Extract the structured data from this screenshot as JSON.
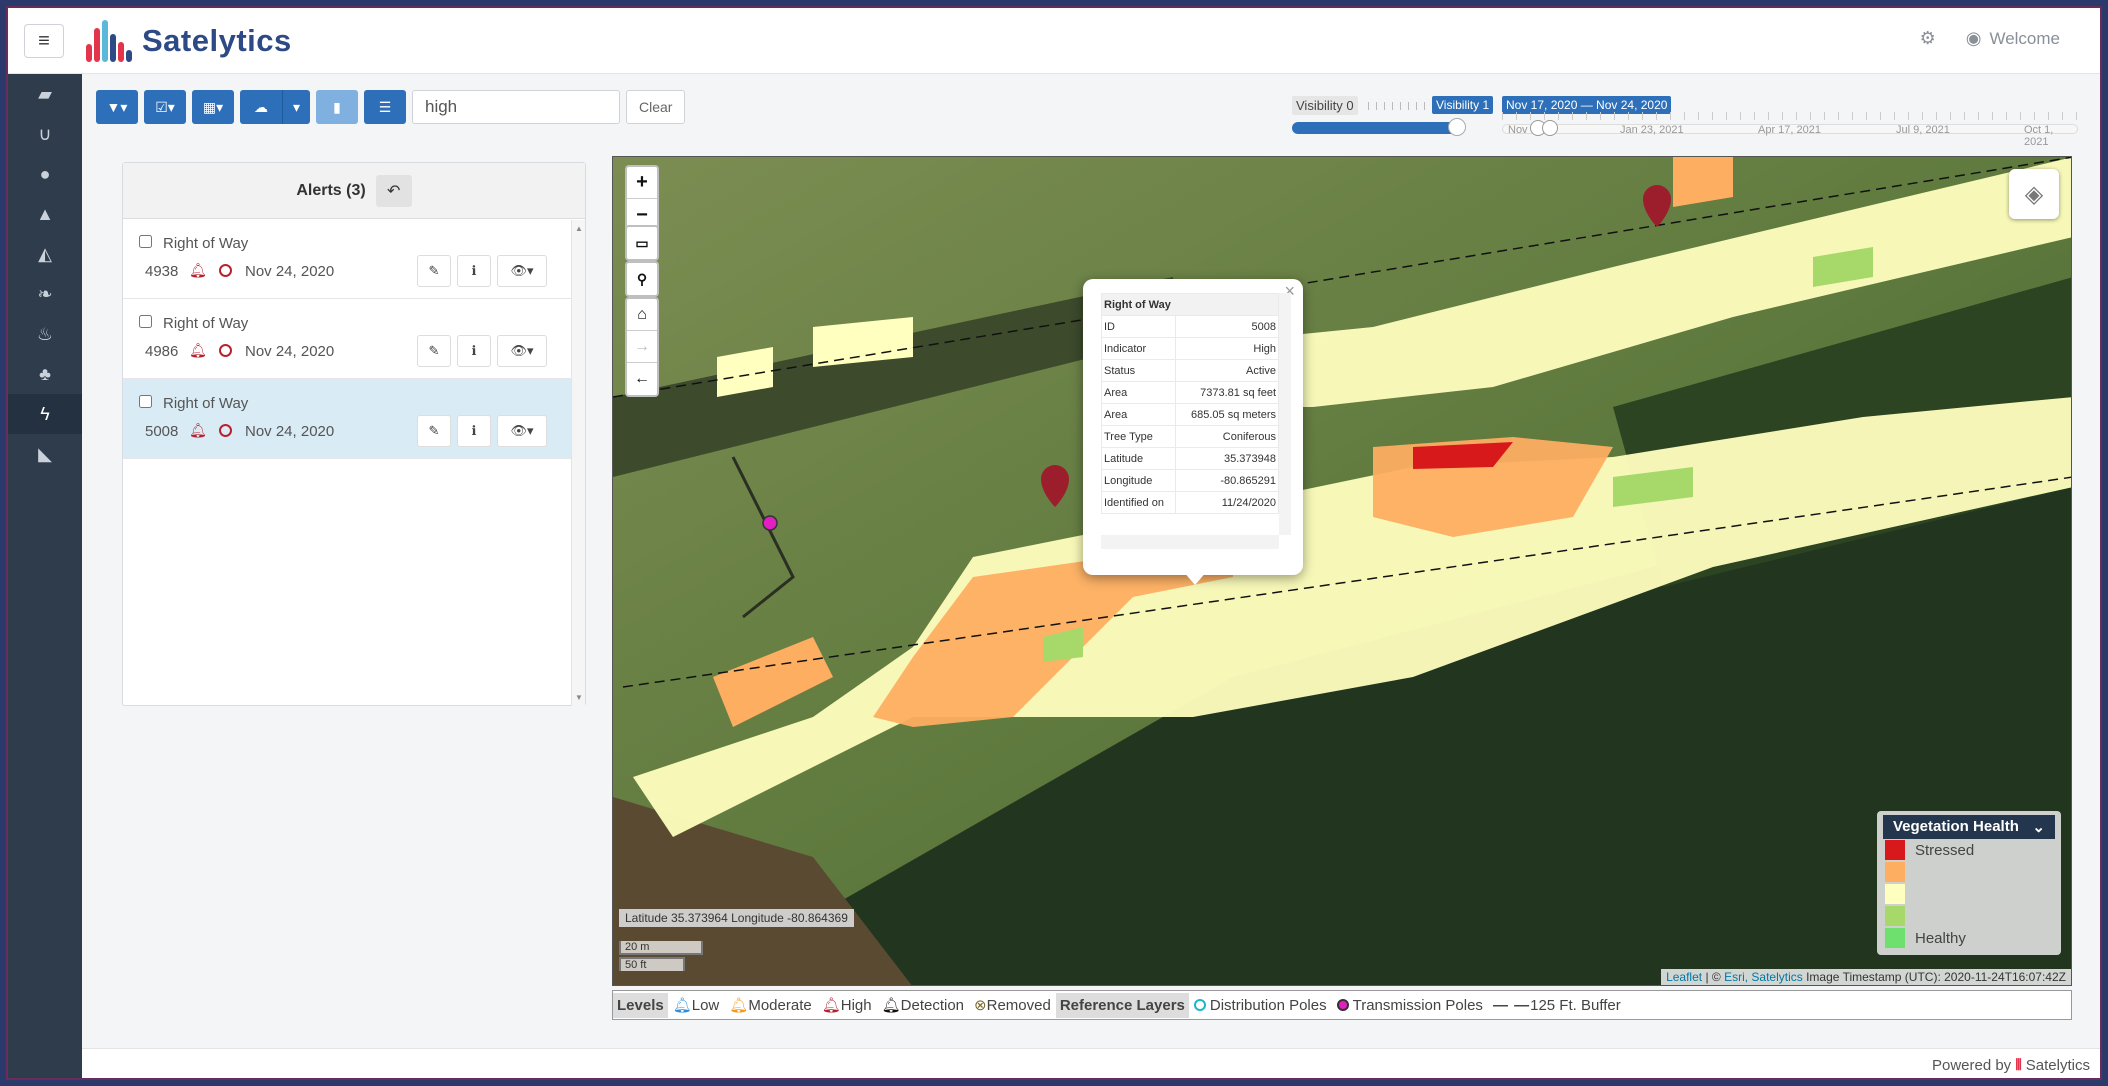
{
  "app": {
    "name": "Satelytics",
    "welcome": "Welcome",
    "powered_by": "Powered by",
    "brand": "Satelytics"
  },
  "toolbar": {
    "search_value": "high",
    "clear_label": "Clear"
  },
  "visibility": {
    "label_min": "Visibility 0",
    "label_value": "Visibility 1",
    "value": 1
  },
  "timeline": {
    "range_label": "Nov 17, 2020 — Nov 24, 2020",
    "ticks": [
      "Nov",
      "Jan 23, 2021",
      "Apr 17, 2021",
      "Jul 9, 2021",
      "Oct 1, 2021"
    ]
  },
  "alerts": {
    "title": "Alerts (3)",
    "items": [
      {
        "title": "Right of Way",
        "id": "4938",
        "date": "Nov 24, 2020",
        "selected": false
      },
      {
        "title": "Right of Way",
        "id": "4986",
        "date": "Nov 24, 2020",
        "selected": false
      },
      {
        "title": "Right of Way",
        "id": "5008",
        "date": "Nov 24, 2020",
        "selected": true
      }
    ]
  },
  "popup": {
    "title": "Right of Way",
    "rows": [
      {
        "k": "ID",
        "v": "5008"
      },
      {
        "k": "Indicator",
        "v": "High"
      },
      {
        "k": "Status",
        "v": "Active"
      },
      {
        "k": "Area",
        "v": "7373.81 sq feet"
      },
      {
        "k": "Area",
        "v": "685.05 sq meters"
      },
      {
        "k": "Tree Type",
        "v": "Coniferous"
      },
      {
        "k": "Latitude",
        "v": "35.373948"
      },
      {
        "k": "Longitude",
        "v": "-80.865291"
      },
      {
        "k": "Identified on",
        "v": "11/24/2020"
      }
    ]
  },
  "map": {
    "coords": "Latitude 35.373964 Longitude -80.864369",
    "scale_m": "20 m",
    "scale_ft": "50 ft",
    "attrib_leaflet": "Leaflet",
    "attrib_sep": " | © ",
    "attrib_esri": "Esri, Satelytics",
    "attrib_ts": " Image Timestamp (UTC): 2020-11-24T16:07:42Z"
  },
  "legend": {
    "title": "Vegetation Health",
    "rows": [
      {
        "label": "Stressed",
        "color": "#d7191c"
      },
      {
        "label": "",
        "color": "#fdae61"
      },
      {
        "label": "",
        "color": "#ffffbf"
      },
      {
        "label": "",
        "color": "#a6d96a"
      },
      {
        "label": "Healthy",
        "color": "#6ee06e"
      }
    ]
  },
  "footer_legend": {
    "levels_label": "Levels",
    "low": "Low",
    "moderate": "Moderate",
    "high": "High",
    "detection": "Detection",
    "removed": "Removed",
    "ref_label": "Reference Layers",
    "dist": "Distribution Poles",
    "trans": "Transmission Poles",
    "buffer": "125 Ft. Buffer"
  },
  "colors": {
    "accent": "#2d6fb8",
    "rail": "#2f3c4c",
    "alert_red": "#b8222f"
  }
}
